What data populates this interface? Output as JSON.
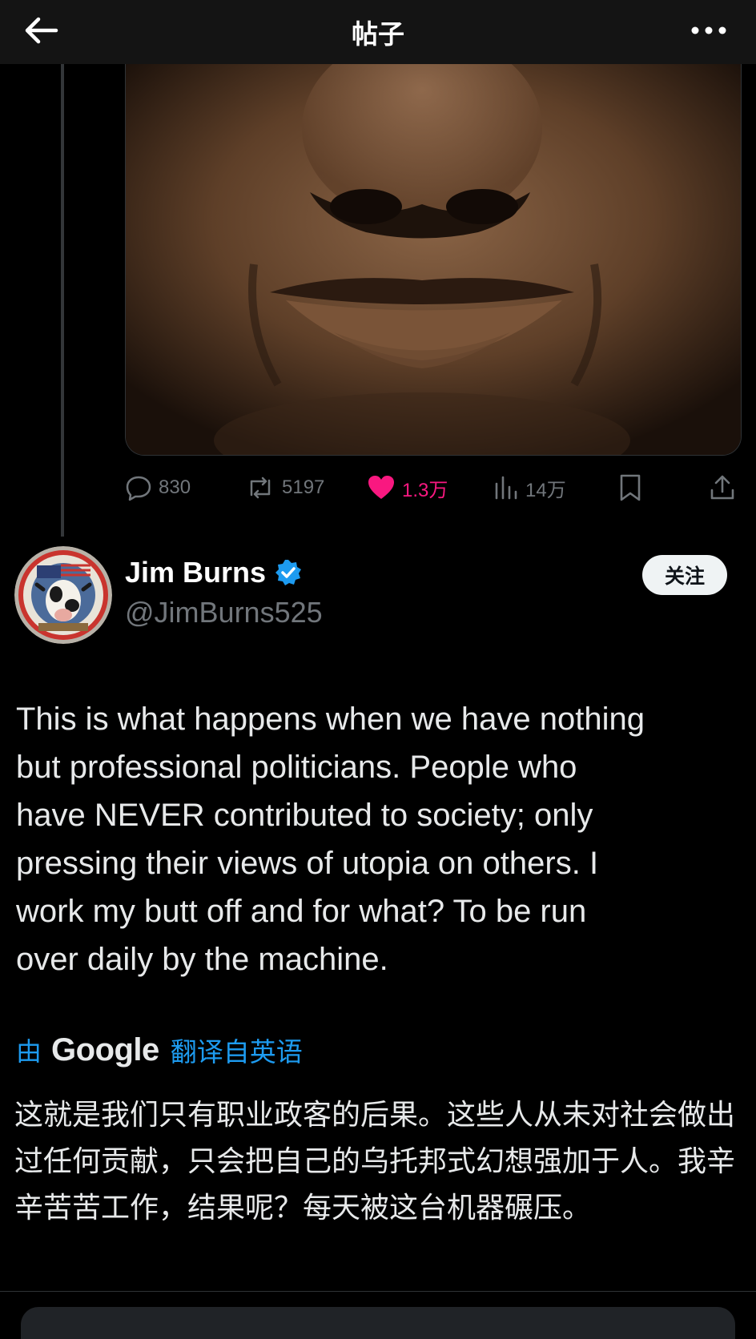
{
  "header": {
    "title": "帖子",
    "back_icon": "arrow-left-icon",
    "more_icon": "more-horizontal-icon"
  },
  "media": {
    "type": "image"
  },
  "actions": {
    "replies": "830",
    "reposts": "5197",
    "likes": "1.3万",
    "views": "14万",
    "liked_color": "#f91880"
  },
  "author": {
    "name": "Jim Burns",
    "handle": "@JimBurns525",
    "verified": true,
    "follow_label": "关注"
  },
  "post": {
    "text": "This is what happens when we have nothing\nbut professional politicians. People who\nhave NEVER contributed to society; only\npressing their views of utopia on others. I\nwork my butt off and for what? To be run\nover daily by the machine."
  },
  "translation": {
    "by": "由",
    "provider": "Google",
    "link": "翻译自英语",
    "text": "这就是我们只有职业政客的后果。这些人从未对社会做出过任何贡献，只会把自己的乌托邦式幻想强加于人。我辛辛苦苦工作，结果呢？每天被这台机器碾压。"
  },
  "colors": {
    "background": "#000000",
    "accent": "#1d9bf0",
    "muted": "#71767b"
  }
}
